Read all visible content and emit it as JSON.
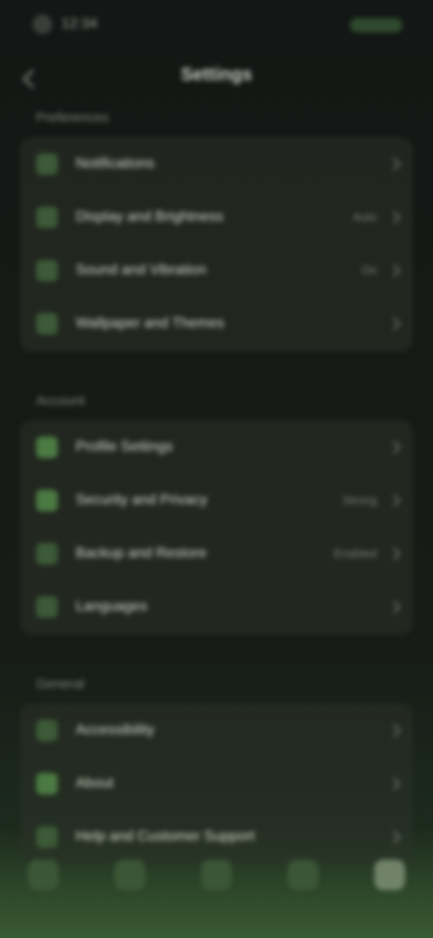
{
  "status_bar": {
    "time": "12:34"
  },
  "header": {
    "title": "Settings"
  },
  "sections": [
    {
      "title": "Preferences",
      "items": [
        {
          "label": "Notifications",
          "value": ""
        },
        {
          "label": "Display and Brightness",
          "value": "Auto"
        },
        {
          "label": "Sound and Vibration",
          "value": "On"
        },
        {
          "label": "Wallpaper and Themes",
          "value": ""
        }
      ]
    },
    {
      "title": "Account",
      "items": [
        {
          "label": "Profile Settings",
          "value": ""
        },
        {
          "label": "Security and Privacy",
          "value": "Strong"
        },
        {
          "label": "Backup and Restore",
          "value": "Enabled"
        },
        {
          "label": "Languages",
          "value": ""
        }
      ]
    },
    {
      "title": "General",
      "items": [
        {
          "label": "Accessibility",
          "value": ""
        },
        {
          "label": "About",
          "value": ""
        },
        {
          "label": "Help and Customer Support",
          "value": ""
        }
      ]
    }
  ],
  "nav": {
    "tabs": [
      "home",
      "search",
      "library",
      "messages",
      "profile"
    ],
    "active": "profile"
  },
  "colors": {
    "background": "#151916",
    "card": "#2c3228",
    "accent_green": "#4b7a43",
    "text_primary": "#d6dccf",
    "text_secondary": "#7d867c"
  }
}
